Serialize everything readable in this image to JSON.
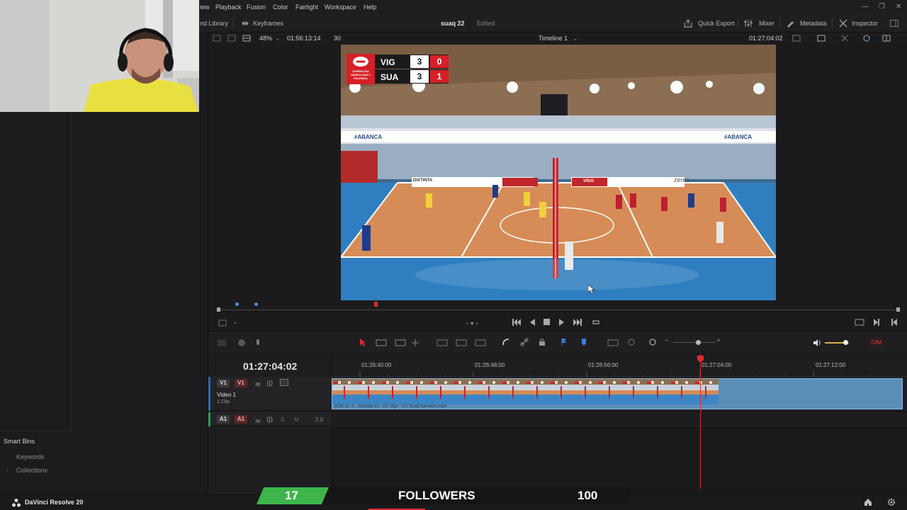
{
  "menubar": {
    "items": [
      "iew",
      "Playback",
      "Fusion",
      "Color",
      "Fairlight",
      "Workspace",
      "Help"
    ]
  },
  "toolbar": {
    "media_library": "nd Library",
    "keyframes": "Keyframes",
    "project_name": "suaq 22",
    "project_status": "Edited",
    "quick_export": "Quick Export",
    "mixer": "Mixer",
    "metadata": "Metadata",
    "inspector": "Inspector"
  },
  "viewer_header": {
    "zoom": "48%",
    "source_timecode": "01:56:13:14",
    "frame_rate": "30",
    "timeline_name": "Timeline 1",
    "record_timecode": "01:27:04:02"
  },
  "scoreboard": {
    "league_text": "SUPERLIGA MASCULINA 2 VOLEIBOL",
    "teams": [
      {
        "name": "VIG",
        "sets": "3",
        "points": "0"
      },
      {
        "name": "SUA",
        "sets": "3",
        "points": "1"
      }
    ]
  },
  "video_text": {
    "sponsor1": "#ABANCA",
    "sponsor2": "#ABANCA",
    "banner1": "DIXTINTA",
    "banner2": "VIGO",
    "banner3": "zeres"
  },
  "timeline": {
    "current_timecode": "01:27:04:02",
    "ruler_labels": [
      "01:26:40:00",
      "01:26:48:00",
      "01:26:56:00",
      "01:27:04:00",
      "01:27:12:00"
    ],
    "video_track": {
      "tag": "V1",
      "patch": "V1",
      "name": "Video 1",
      "clips": "1 Clip"
    },
    "clip_filename": "[CM] Gr. A - Jornada 13 - CV Vigo - CV Suaq Sanseiro.mp4",
    "audio_track": {
      "tag": "A1",
      "patch": "A1",
      "solo": "S",
      "mute": "M",
      "level": "2.0"
    },
    "dim_label": "DIM"
  },
  "left_panel": {
    "smart_bins": "Smart Bins",
    "keywords": "Keywords",
    "collections": "Collections"
  },
  "bottom_bar": {
    "app_name": "DaVinci Resolve 20"
  },
  "followers_overlay": {
    "current": "17",
    "label": "FOLLOWERS",
    "goal": "100"
  },
  "colors": {
    "accent_red": "#e02a2a",
    "clip_blue": "#5a8fba",
    "overlay_green": "#3db54a",
    "track_green": "#2f9e5a"
  }
}
